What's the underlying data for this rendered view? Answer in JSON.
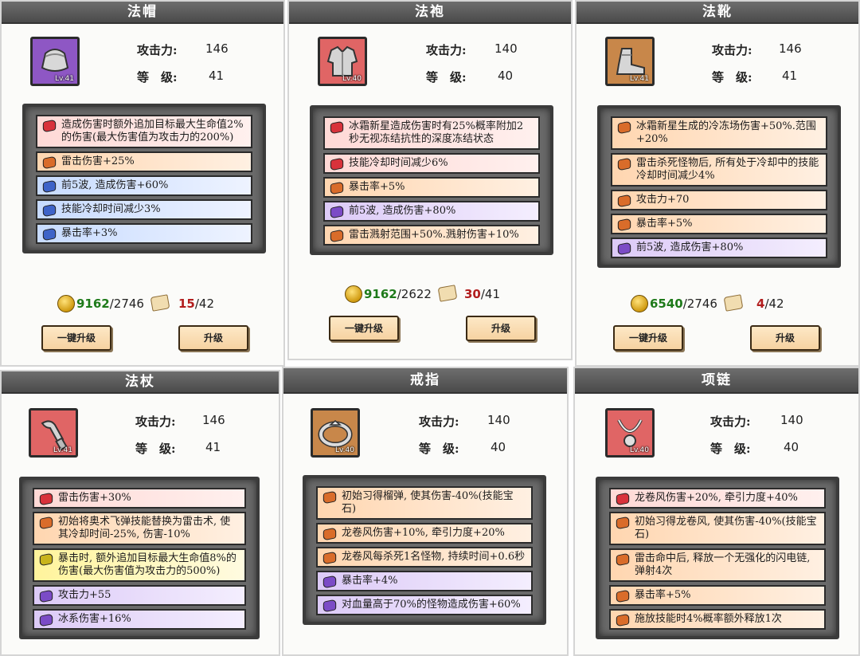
{
  "labels": {
    "attack": "攻击力:",
    "level": "等　级:"
  },
  "cards": [
    {
      "title": "法帽",
      "icon": "hat-icon",
      "icon_bg": "#8e57c4",
      "lv": "Lv.41",
      "attack": "146",
      "level": "41",
      "affixes": [
        {
          "color": "red",
          "text": "造成伤害时额外追加目标最大生命值2%的伤害(最大伤害值为攻击力的200%)"
        },
        {
          "color": "orange",
          "text": "雷击伤害+25%"
        },
        {
          "color": "blue",
          "text": "前5波, 造成伤害+60%"
        },
        {
          "color": "blue",
          "text": "技能冷却时间减少3%"
        },
        {
          "color": "blue",
          "text": "暴击率+3%"
        }
      ],
      "gold_have": "9162",
      "gold_need": "/2746",
      "gold_have_color": "green",
      "scroll_have": "15",
      "scroll_need": "/42",
      "scroll_have_color": "red",
      "btn_quick": "一键升级",
      "btn_upgrade": "升级"
    },
    {
      "title": "法袍",
      "icon": "robe-icon",
      "icon_bg": "#e06565",
      "lv": "Lv.40",
      "attack": "140",
      "level": "40",
      "affixes": [
        {
          "color": "red",
          "text": "冰霜新星造成伤害时有25%概率附加2秒无视冻结抗性的深度冻结状态"
        },
        {
          "color": "red",
          "text": "技能冷却时间减少6%"
        },
        {
          "color": "orange",
          "text": "暴击率+5%"
        },
        {
          "color": "purple",
          "text": "前5波, 造成伤害+80%"
        },
        {
          "color": "orange",
          "text": "雷击溅射范围+50%.溅射伤害+10%"
        }
      ],
      "gold_have": "9162",
      "gold_need": "/2622",
      "gold_have_color": "green",
      "scroll_have": "30",
      "scroll_need": "/41",
      "scroll_have_color": "red",
      "btn_quick": "一键升级",
      "btn_upgrade": "升级"
    },
    {
      "title": "法靴",
      "icon": "boots-icon",
      "icon_bg": "#c8874a",
      "lv": "Lv.41",
      "attack": "146",
      "level": "41",
      "affixes": [
        {
          "color": "orange",
          "text": "冰霜新星生成的冷冻场伤害+50%.范围+20%"
        },
        {
          "color": "orange",
          "text": "雷击杀死怪物后, 所有处于冷却中的技能冷却时间减少4%"
        },
        {
          "color": "orange",
          "text": "攻击力+70"
        },
        {
          "color": "orange",
          "text": "暴击率+5%"
        },
        {
          "color": "purple",
          "text": "前5波, 造成伤害+80%"
        }
      ],
      "gold_have": "6540",
      "gold_need": "/2746",
      "gold_have_color": "green",
      "scroll_have": "4",
      "scroll_need": "/42",
      "scroll_have_color": "red",
      "btn_quick": "一键升级",
      "btn_upgrade": "升级"
    },
    {
      "title": "法杖",
      "icon": "staff-icon",
      "icon_bg": "#e06565",
      "lv": "Lv.41",
      "attack": "146",
      "level": "41",
      "affixes": [
        {
          "color": "red",
          "text": "雷击伤害+30%"
        },
        {
          "color": "orange",
          "text": "初始将奥术飞弹技能替换为雷击术, 使其冷却时间-25%, 伤害-10%"
        },
        {
          "color": "yellow",
          "text": "暴击时, 额外追加目标最大生命值8%的伤害(最大伤害值为攻击力的500%)"
        },
        {
          "color": "purple",
          "text": "攻击力+55"
        },
        {
          "color": "purple",
          "text": "冰系伤害+16%"
        }
      ]
    },
    {
      "title": "戒指",
      "icon": "ring-icon",
      "icon_bg": "#c8874a",
      "lv": "Lv.40",
      "attack": "140",
      "level": "40",
      "affixes": [
        {
          "color": "orange",
          "text": "初始习得榴弹, 使其伤害-40%(技能宝石)"
        },
        {
          "color": "orange",
          "text": "龙卷风伤害+10%, 牵引力度+20%"
        },
        {
          "color": "orange",
          "text": "龙卷风每杀死1名怪物, 持续时间+0.6秒"
        },
        {
          "color": "purple",
          "text": "暴击率+4%"
        },
        {
          "color": "purple",
          "text": "对血量高于70%的怪物造成伤害+60%"
        }
      ]
    },
    {
      "title": "项链",
      "icon": "necklace-icon",
      "icon_bg": "#e06565",
      "lv": "Lv.40",
      "attack": "140",
      "level": "40",
      "affixes": [
        {
          "color": "red",
          "text": "龙卷风伤害+20%, 牵引力度+40%"
        },
        {
          "color": "orange",
          "text": "初始习得龙卷风, 使其伤害-40%(技能宝石)"
        },
        {
          "color": "orange",
          "text": "雷击命中后, 释放一个无强化的闪电链, 弹射4次"
        },
        {
          "color": "orange",
          "text": "暴击率+5%"
        },
        {
          "color": "orange",
          "text": "施放技能时4%概率额外释放1次"
        }
      ]
    }
  ]
}
